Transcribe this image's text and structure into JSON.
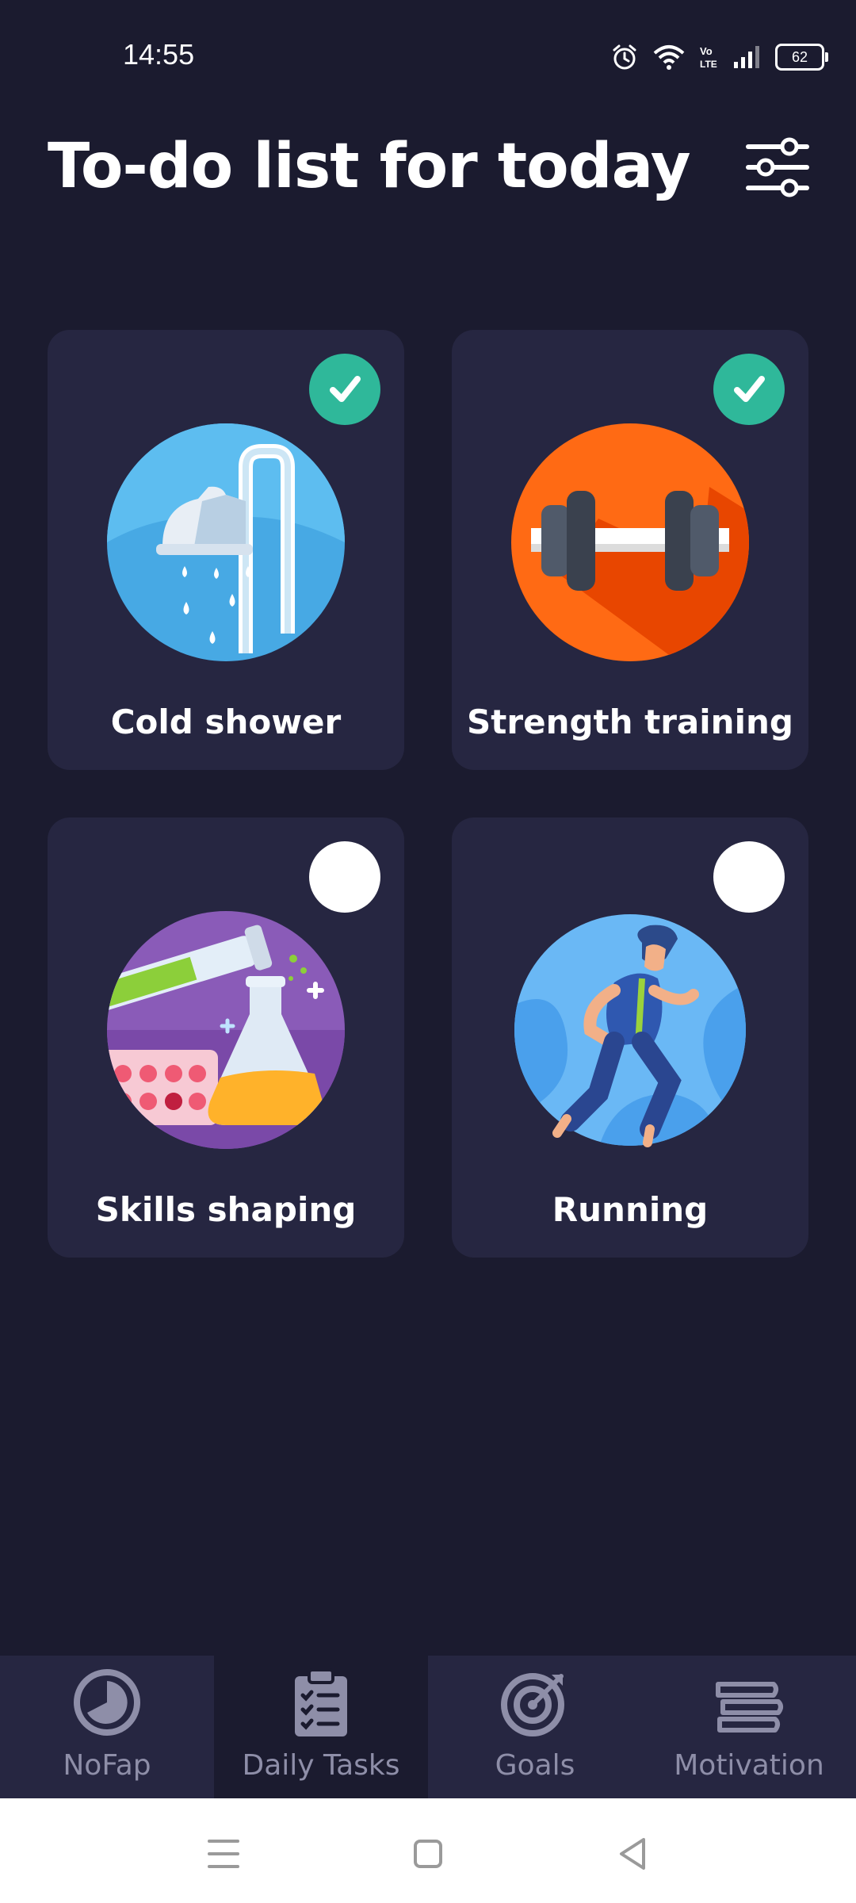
{
  "status_bar": {
    "time": "14:55",
    "battery": "62",
    "icons": [
      "alarm-icon",
      "wifi-icon",
      "volte-icon",
      "signal-icon",
      "battery-icon"
    ]
  },
  "header": {
    "title": "To-do list for today",
    "settings_icon": "sliders-icon"
  },
  "tasks": [
    {
      "label": "Cold shower",
      "done": true,
      "icon": "shower-icon"
    },
    {
      "label": "Strength training",
      "done": true,
      "icon": "dumbbell-icon"
    },
    {
      "label": "Skills shaping",
      "done": false,
      "icon": "chemistry-flask-icon"
    },
    {
      "label": "Running",
      "done": false,
      "icon": "runner-icon"
    }
  ],
  "bottom_nav": {
    "active": "Daily Tasks",
    "items": [
      {
        "label": "NoFap",
        "icon": "timer-icon"
      },
      {
        "label": "Daily Tasks",
        "icon": "clipboard-checklist-icon"
      },
      {
        "label": "Goals",
        "icon": "target-icon"
      },
      {
        "label": "Motivation",
        "icon": "books-icon"
      }
    ]
  },
  "colors": {
    "background": "#1b1b2f",
    "card": "#262641",
    "check_done": "#2fb89a",
    "nav_label": "#8e8ea8"
  }
}
